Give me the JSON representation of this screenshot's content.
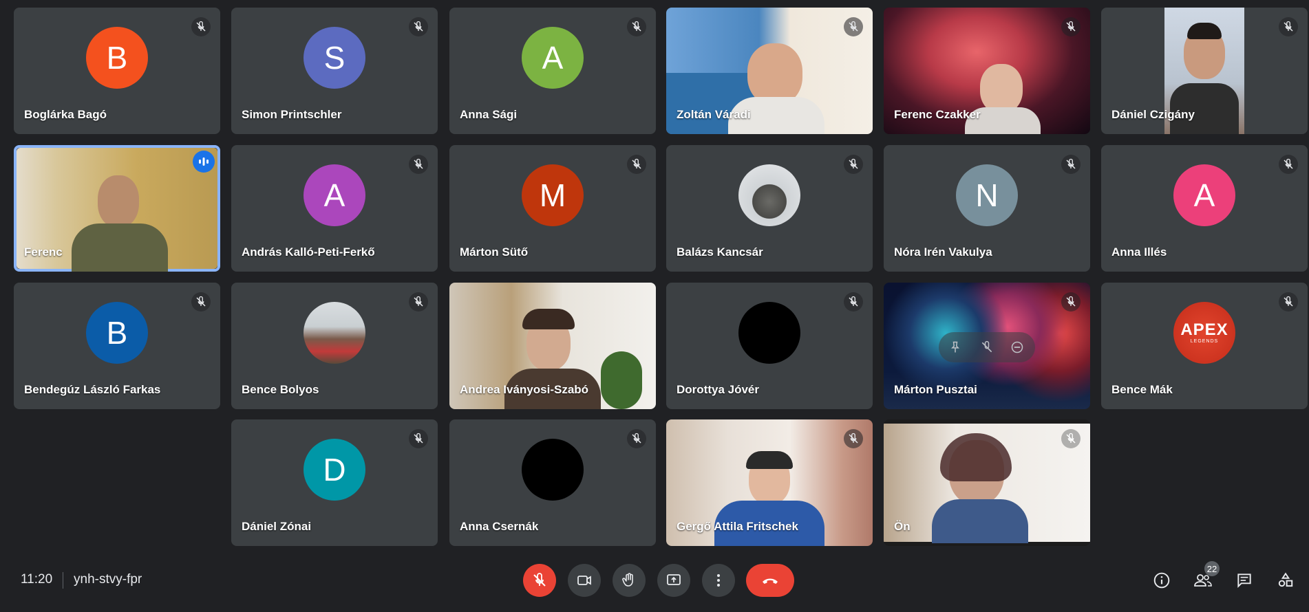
{
  "participants": [
    {
      "name": "Boglárka Bagó",
      "initial": "B",
      "color": "#f4511e"
    },
    {
      "name": "Simon Printschler",
      "initial": "S",
      "color": "#5c6bc0"
    },
    {
      "name": "Anna Sági",
      "initial": "A",
      "color": "#7cb342"
    },
    {
      "name": "Zoltán Váradi"
    },
    {
      "name": "Ferenc Czakker"
    },
    {
      "name": "Dániel Czigány"
    },
    {
      "name": "Ferenc"
    },
    {
      "name": "András Kalló-Peti-Ferkő",
      "initial": "A",
      "color": "#ab47bc"
    },
    {
      "name": "Márton Sütő",
      "initial": "M",
      "color": "#bf360c"
    },
    {
      "name": "Balázs Kancsár"
    },
    {
      "name": "Nóra Irén Vakulya",
      "initial": "N",
      "color": "#78909c"
    },
    {
      "name": "Anna Illés",
      "initial": "A",
      "color": "#ec407a"
    },
    {
      "name": "Bendegúz László Farkas",
      "initial": "B",
      "color": "#0b5ca8"
    },
    {
      "name": "Bence Bolyos"
    },
    {
      "name": "Andrea Iványosi-Szabó"
    },
    {
      "name": "Dorottya Jóvér"
    },
    {
      "name": "Márton Pusztai"
    },
    {
      "name": "Bence Mák",
      "avatar_text": "APEX",
      "avatar_subtext": "LEGENDS"
    },
    {
      "name": "Dániel Zónai",
      "initial": "D",
      "color": "#0097a7"
    },
    {
      "name": "Anna Csernák"
    },
    {
      "name": "Gergő Attila Fritschek"
    },
    {
      "name": "Ön"
    }
  ],
  "meeting": {
    "time": "11:20",
    "code": "ynh-stvy-fpr"
  },
  "people_count": "22",
  "colors": {
    "end_call": "#ea4335",
    "speaking": "#1a73e8",
    "tile": "#3c4043",
    "background": "#202124"
  }
}
